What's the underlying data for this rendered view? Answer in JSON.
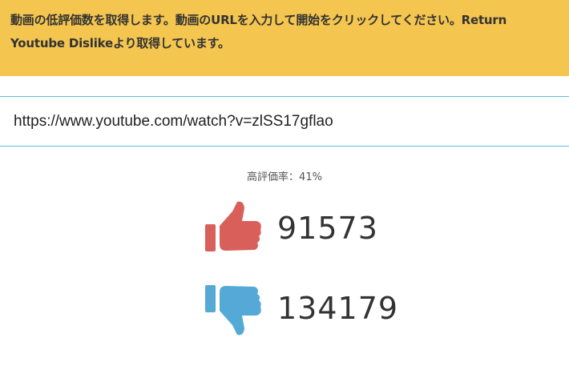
{
  "banner": {
    "text": "動画の低評価数を取得します。動画のURLを入力して開始をクリックしてください。Return Youtube Dislikeより取得しています。"
  },
  "url_input": {
    "value": "https://www.youtube.com/watch?v=zlSS17gflao"
  },
  "ratio": {
    "label": "高評価率：",
    "value": "41%"
  },
  "likes": {
    "count": "91573",
    "icon": "thumbs-up-icon",
    "color": "#d9605a"
  },
  "dislikes": {
    "count": "134179",
    "icon": "thumbs-down-icon",
    "color": "#55a9d6"
  }
}
